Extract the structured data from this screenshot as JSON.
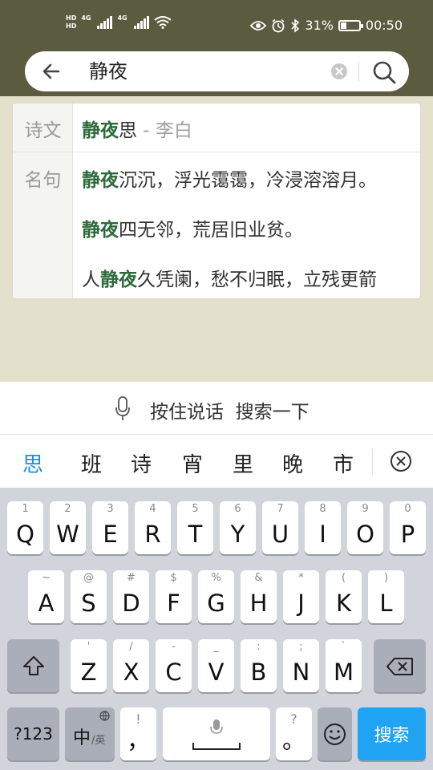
{
  "status": {
    "hd1": "HD",
    "hd2": "HD",
    "net1": "4G",
    "net2": "4G",
    "battery_pct": "31%",
    "battery_level": 31,
    "time": "00:50"
  },
  "search": {
    "query": "静夜"
  },
  "results": {
    "poem_label": "诗文",
    "poem": {
      "hl": "静夜",
      "rest": "思",
      "author": " - 李白"
    },
    "quote_label": "名句",
    "quotes": [
      {
        "pre": "",
        "hl": "静夜",
        "rest": "沉沉，浮光霭霭，冷浸溶溶月。"
      },
      {
        "pre": "",
        "hl": "静夜",
        "rest": "四无邻，荒居旧业贫。"
      },
      {
        "pre": "人",
        "hl": "静夜",
        "rest": "久凭阑，愁不归眠，立残更箭"
      }
    ]
  },
  "voice": {
    "label": "按住说话  搜索一下"
  },
  "candidates": [
    "思",
    "班",
    "诗",
    "宵",
    "里",
    "晚",
    "市"
  ],
  "keyboard": {
    "row1": [
      {
        "sub": "1",
        "main": "Q"
      },
      {
        "sub": "2",
        "main": "W"
      },
      {
        "sub": "3",
        "main": "E"
      },
      {
        "sub": "4",
        "main": "R"
      },
      {
        "sub": "5",
        "main": "T"
      },
      {
        "sub": "6",
        "main": "Y"
      },
      {
        "sub": "7",
        "main": "U"
      },
      {
        "sub": "8",
        "main": "I"
      },
      {
        "sub": "9",
        "main": "O"
      },
      {
        "sub": "0",
        "main": "P"
      }
    ],
    "row2": [
      {
        "sub": "~",
        "main": "A"
      },
      {
        "sub": "@",
        "main": "S"
      },
      {
        "sub": "#",
        "main": "D"
      },
      {
        "sub": "$",
        "main": "F"
      },
      {
        "sub": "%",
        "main": "G"
      },
      {
        "sub": "&",
        "main": "H"
      },
      {
        "sub": "*",
        "main": "J"
      },
      {
        "sub": "(",
        "main": "K"
      },
      {
        "sub": ")",
        "main": "L"
      }
    ],
    "row3": [
      {
        "sub": "'",
        "main": "Z"
      },
      {
        "sub": "/",
        "main": "X"
      },
      {
        "sub": "-",
        "main": "C"
      },
      {
        "sub": "_",
        "main": "V"
      },
      {
        "sub": ":",
        "main": "B"
      },
      {
        "sub": ";",
        "main": "N"
      },
      {
        "sub": "`",
        "main": "M"
      }
    ],
    "num_key": "?123",
    "lang_key_main": "中",
    "lang_key_sub": "/英",
    "comma_sub": "!",
    "comma_main": "，",
    "period_sub": "?",
    "period_main": "。",
    "search_key": "搜索"
  }
}
